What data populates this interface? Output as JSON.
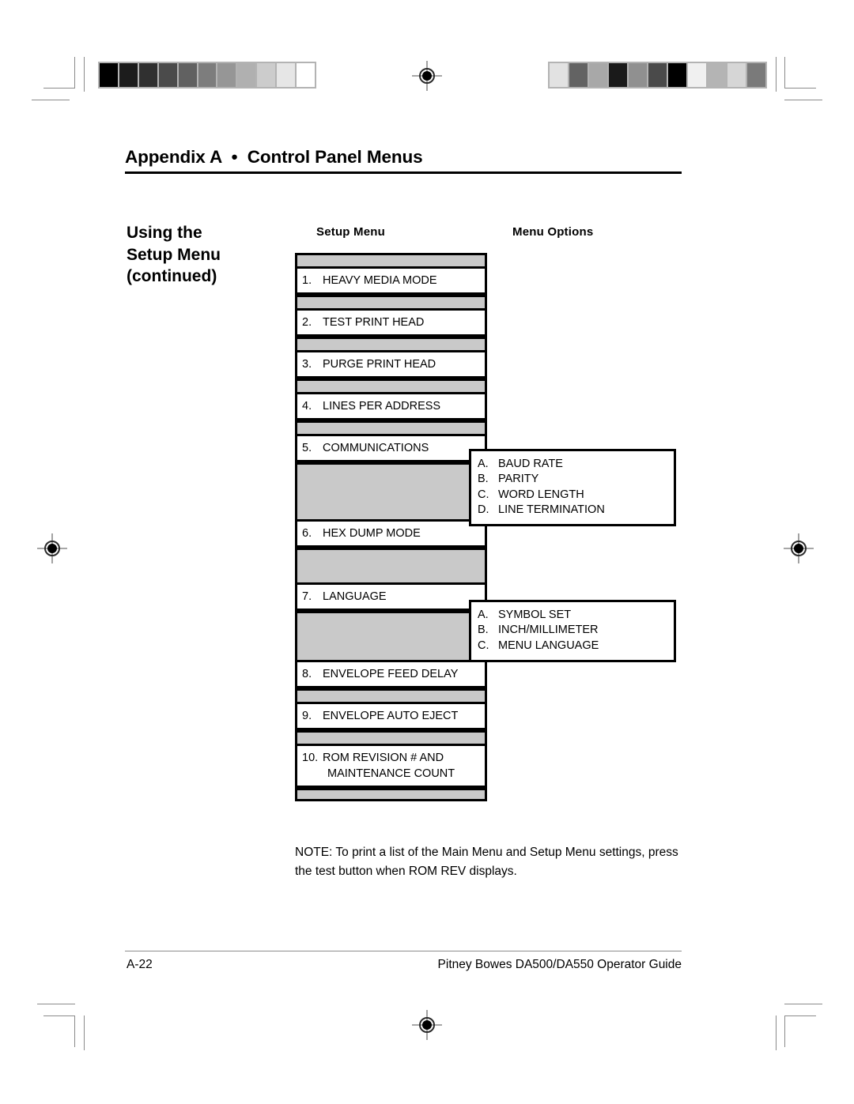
{
  "document": {
    "chapter_title": "Appendix A  •  Control Panel Menus",
    "side_heading_line1": "Using the",
    "side_heading_line2": "Setup Menu",
    "side_heading_line3": "(continued)",
    "column_headers": {
      "left": "Setup Menu",
      "right": "Menu Options"
    },
    "note": "NOTE: To print a list of the Main Menu and Setup Menu settings, press the test button when ROM REV displays.",
    "footer": {
      "page_number": "A-22",
      "guide_title": "Pitney Bowes DA500/DA550 Operator Guide"
    }
  },
  "menu": {
    "items": [
      {
        "number": "1.",
        "label": "HEAVY MEDIA MODE"
      },
      {
        "number": "2.",
        "label": "TEST PRINT HEAD"
      },
      {
        "number": "3.",
        "label": "PURGE PRINT HEAD"
      },
      {
        "number": "4.",
        "label": "LINES PER ADDRESS"
      },
      {
        "number": "5.",
        "label": "COMMUNICATIONS"
      },
      {
        "number": "6.",
        "label": "HEX DUMP MODE"
      },
      {
        "number": "7.",
        "label": "LANGUAGE"
      },
      {
        "number": "8.",
        "label": "ENVELOPE FEED DELAY"
      },
      {
        "number": "9.",
        "label": "ENVELOPE AUTO EJECT"
      },
      {
        "number": "10.",
        "label": "ROM REVISION # AND",
        "label_line2": "MAINTENANCE COUNT"
      }
    ]
  },
  "options": {
    "communications": [
      {
        "letter": "A.",
        "label": "BAUD RATE"
      },
      {
        "letter": "B.",
        "label": "PARITY"
      },
      {
        "letter": "C.",
        "label": "WORD LENGTH"
      },
      {
        "letter": "D.",
        "label": "LINE TERMINATION"
      }
    ],
    "language": [
      {
        "letter": "A.",
        "label": "SYMBOL SET"
      },
      {
        "letter": "B.",
        "label": "INCH/MILLIMETER"
      },
      {
        "letter": "C.",
        "label": "MENU LANGUAGE"
      }
    ]
  },
  "print_marks": {
    "greyscale_left": [
      "#000000",
      "#1c1c1c",
      "#303030",
      "#4b4b4b",
      "#616161",
      "#7d7d7d",
      "#969696",
      "#b0b0b0",
      "#cccccc",
      "#e6e6e6",
      "#ffffff"
    ],
    "greyscale_right": [
      "#e2e2e2",
      "#636363",
      "#a8a8a8",
      "#1a1a1a",
      "#909090",
      "#4a4a4a",
      "#000000",
      "#f0f0f0",
      "#b4b4b4",
      "#d6d6d6",
      "#7a7a7a"
    ]
  },
  "colors": {
    "band_fill": "#c9c9c9",
    "border": "#000000",
    "crop_mark": "#8a8a8a"
  }
}
